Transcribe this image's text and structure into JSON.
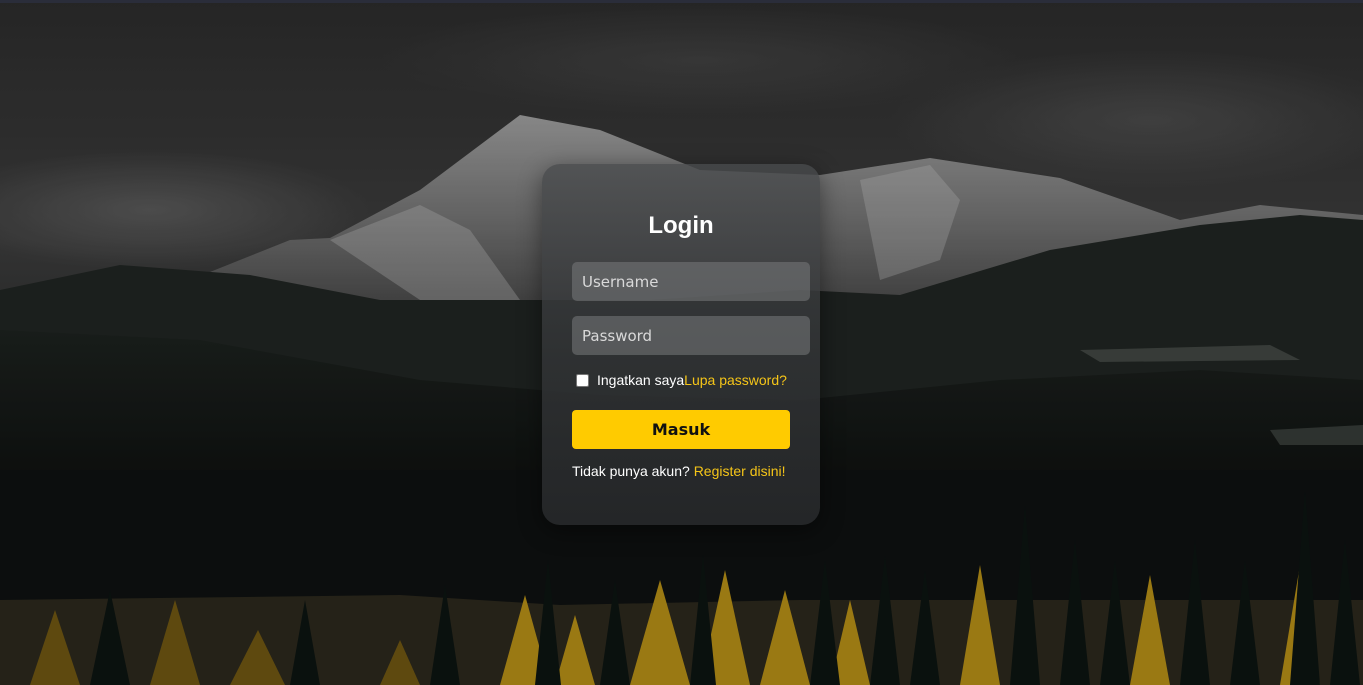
{
  "login": {
    "title": "Login",
    "username_placeholder": "Username",
    "password_placeholder": "Password",
    "remember_label": "Ingatkan saya",
    "forgot_link": "Lupa password?",
    "submit_label": "Masuk",
    "register_prompt": "Tidak punya akun? ",
    "register_link": "Register disini!"
  },
  "colors": {
    "accent": "#ffcb00",
    "link": "#f5c518",
    "card": "#3a3c3e"
  }
}
